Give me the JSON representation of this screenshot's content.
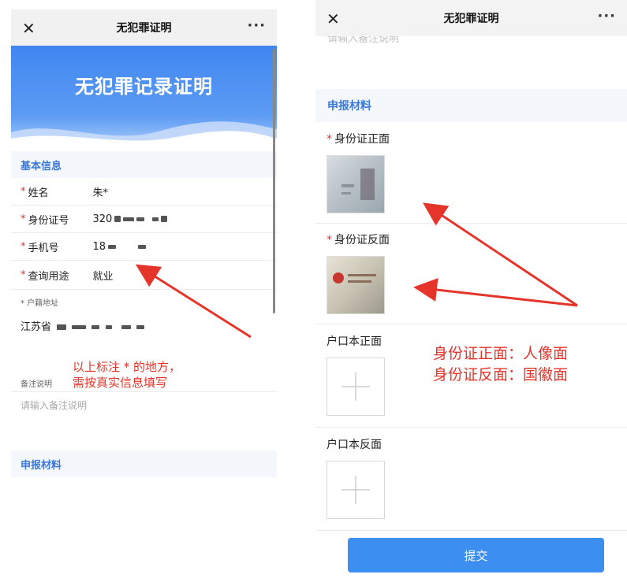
{
  "left_screen": {
    "nav": {
      "close": "✕",
      "title": "无犯罪证明",
      "more": "···"
    },
    "banner_title": "无犯罪记录证明",
    "basic_info_header": "基本信息",
    "star": "*",
    "fields": [
      {
        "label": "姓名",
        "value": "朱*"
      },
      {
        "label": "身份证号",
        "value": "320"
      },
      {
        "label": "手机号",
        "value": "18"
      },
      {
        "label": "查询用途",
        "value": "就业"
      }
    ],
    "household_label": "* 户籍地址",
    "household_value": "江苏省",
    "remark_label": "备注说明",
    "remark_placeholder": "请输入备注说明",
    "materials_header": "申报材料",
    "annotation_line1": "以上标注 * 的地方，",
    "annotation_line2": "需按真实信息填写"
  },
  "right_screen": {
    "nav": {
      "close": "✕",
      "title": "无犯罪证明",
      "more": "···"
    },
    "remark_placeholder_cut": "请输入备注说明",
    "materials_header": "申报材料",
    "star": "*",
    "id_front_label": "身份证正面",
    "id_back_label": "身份证反面",
    "household_front_label": "户口本正面",
    "household_back_label": "户口本反面",
    "submit_label": "提交",
    "annotation_line1": "身份证正面：人像面",
    "annotation_line2": "身份证反面：国徽面"
  },
  "colors": {
    "accent": "#3c8ef0",
    "section_text": "#3b78d8",
    "required_star": "#e5352b",
    "annotation": "#e5352b"
  }
}
